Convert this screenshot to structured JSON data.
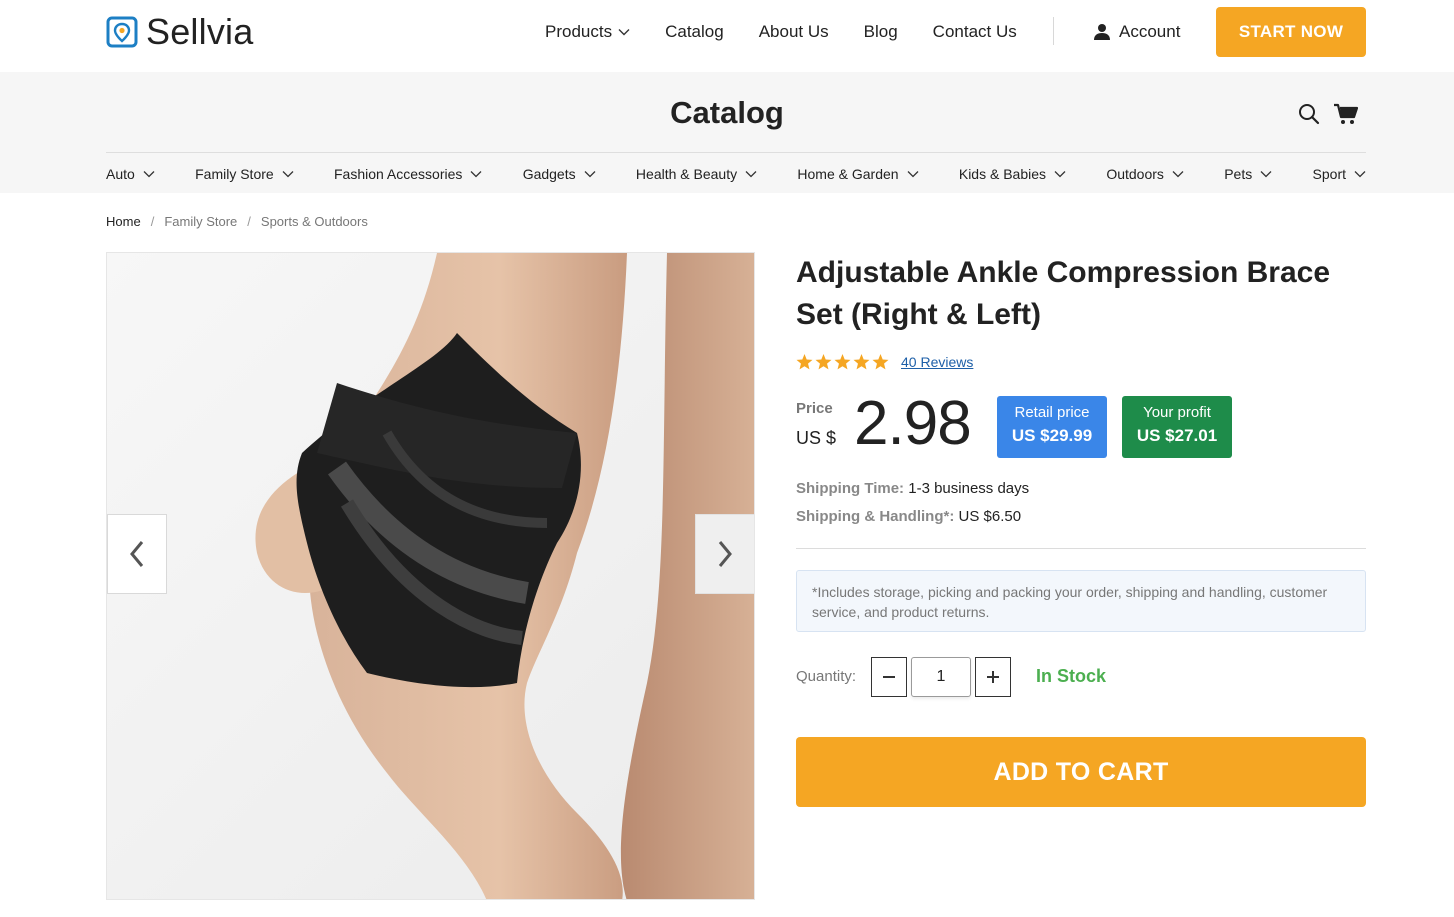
{
  "header": {
    "brand": "Sellvia",
    "nav": [
      {
        "label": "Products",
        "has_dropdown": true
      },
      {
        "label": "Catalog"
      },
      {
        "label": "About Us"
      },
      {
        "label": "Blog"
      },
      {
        "label": "Contact Us"
      }
    ],
    "account_label": "Account",
    "cta_label": "START NOW",
    "accent_color": "#f5a623"
  },
  "catalog_band": {
    "title": "Catalog",
    "categories": [
      "Auto",
      "Family Store",
      "Fashion Accessories",
      "Gadgets",
      "Health & Beauty",
      "Home & Garden",
      "Kids & Babies",
      "Outdoors",
      "Pets",
      "Sport"
    ]
  },
  "breadcrumb": [
    "Home",
    "Family Store",
    "Sports & Outdoors"
  ],
  "product": {
    "title": "Adjustable Ankle Compression Brace Set (Right & Left)",
    "rating": 5,
    "reviews_label": "40 Reviews",
    "price_label": "Price",
    "price_currency": "US $",
    "price_value": "2.98",
    "retail_label": "Retail price",
    "retail_value": "US $29.99",
    "profit_label": "Your profit",
    "profit_value": "US $27.01",
    "shipping_time_label": "Shipping Time:",
    "shipping_time_value": "1-3 business days",
    "shipping_handling_label": "Shipping & Handling*:",
    "shipping_handling_value": "US $6.50",
    "note": "*Includes storage, picking and packing your order, shipping and handling, customer service, and product returns.",
    "quantity_label": "Quantity:",
    "quantity_value": "1",
    "stock_status": "In Stock",
    "add_to_cart_label": "ADD TO CART",
    "colors": {
      "retail": "#3a86e8",
      "profit": "#1e8c4a",
      "in_stock": "#4caf50",
      "star": "#f5a623"
    }
  }
}
